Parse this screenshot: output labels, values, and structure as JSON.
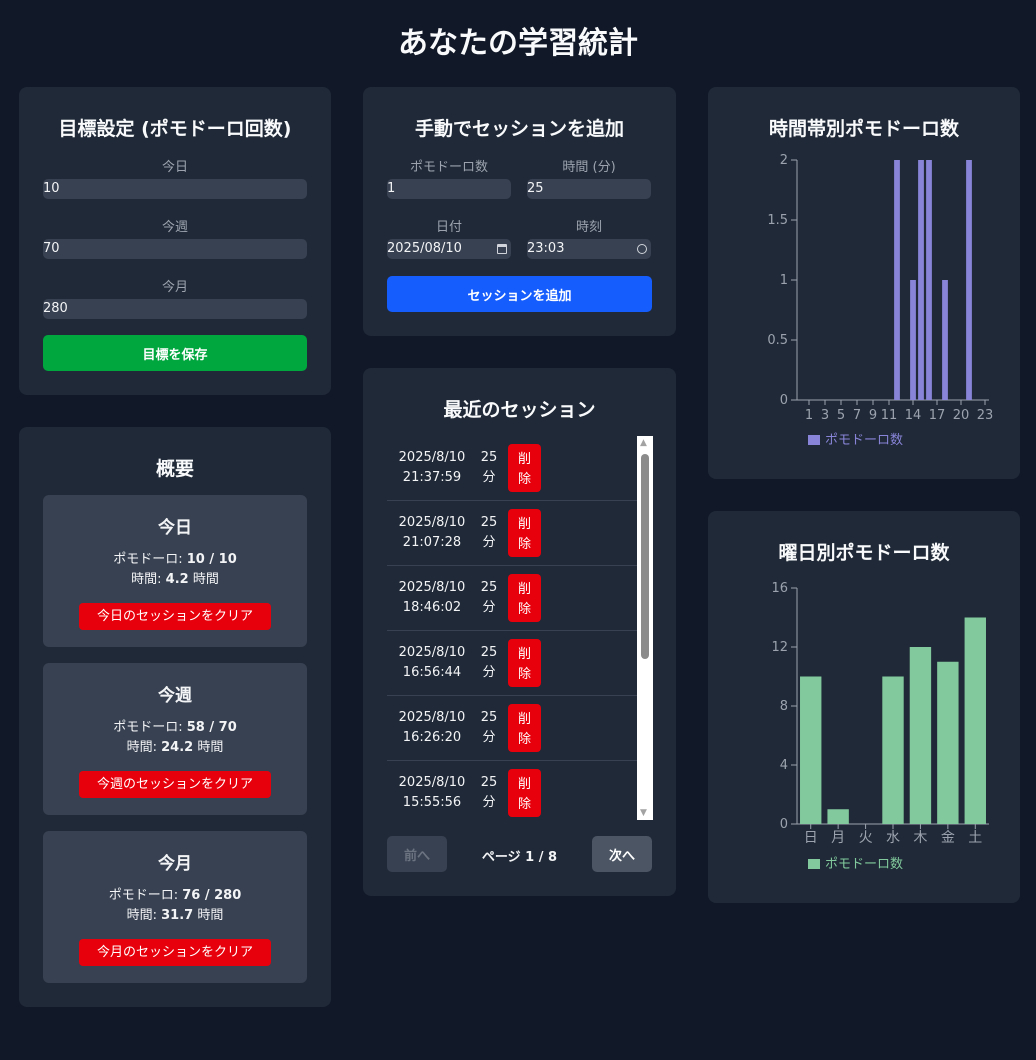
{
  "page": {
    "title": "あなたの学習統計"
  },
  "goals": {
    "title": "目標設定 (ポモドーロ回数)",
    "today_label": "今日",
    "today_value": "10",
    "week_label": "今週",
    "week_value": "70",
    "month_label": "今月",
    "month_value": "280",
    "save_button": "目標を保存"
  },
  "overview": {
    "title": "概要",
    "today": {
      "title": "今日",
      "pomo_label": "ポモドーロ: ",
      "pomo_value": "10 / 10",
      "time_label": "時間: ",
      "time_value": "4.2",
      "time_unit": " 時間",
      "clear_button": "今日のセッションをクリア"
    },
    "week": {
      "title": "今週",
      "pomo_label": "ポモドーロ: ",
      "pomo_value": "58 / 70",
      "time_label": "時間: ",
      "time_value": "24.2",
      "time_unit": " 時間",
      "clear_button": "今週のセッションをクリア"
    },
    "month": {
      "title": "今月",
      "pomo_label": "ポモドーロ: ",
      "pomo_value": "76 / 280",
      "time_label": "時間: ",
      "time_value": "31.7",
      "time_unit": " 時間",
      "clear_button": "今月のセッションをクリア"
    }
  },
  "manual": {
    "title": "手動でセッションを追加",
    "count_label": "ポモドーロ数",
    "count_value": "1",
    "minutes_label": "時間 (分)",
    "minutes_value": "25",
    "date_label": "日付",
    "date_value": "2025/08/10",
    "time_label": "時刻",
    "time_value": "23:03",
    "add_button": "セッションを追加"
  },
  "recent": {
    "title": "最近のセッション",
    "delete_label_1": "削",
    "delete_label_2": "除",
    "sessions": [
      {
        "date": "2025/8/10",
        "time": "21:37:59",
        "dur_num": "25",
        "dur_unit": "分"
      },
      {
        "date": "2025/8/10",
        "time": "21:07:28",
        "dur_num": "25",
        "dur_unit": "分"
      },
      {
        "date": "2025/8/10",
        "time": "18:46:02",
        "dur_num": "25",
        "dur_unit": "分"
      },
      {
        "date": "2025/8/10",
        "time": "16:56:44",
        "dur_num": "25",
        "dur_unit": "分"
      },
      {
        "date": "2025/8/10",
        "time": "16:26:20",
        "dur_num": "25",
        "dur_unit": "分"
      },
      {
        "date": "2025/8/10",
        "time": "15:55:56",
        "dur_num": "25",
        "dur_unit": "分"
      }
    ],
    "prev_button": "前へ",
    "page_info": "ページ 1 / 8",
    "next_button": "次へ"
  },
  "colors": {
    "hour_bar": "#8884d8",
    "weekday_bar": "#82ca9d",
    "axis": "#9ca3af"
  },
  "chart_data": [
    {
      "type": "bar",
      "title": "時間帯別ポモドーロ数",
      "x": [
        0,
        1,
        2,
        3,
        4,
        5,
        6,
        7,
        8,
        9,
        10,
        11,
        12,
        13,
        14,
        15,
        16,
        17,
        18,
        19,
        20,
        21,
        22,
        23
      ],
      "x_tick_labels": [
        "1",
        "3",
        "5",
        "7",
        "9",
        "11",
        "14",
        "17",
        "20",
        "23"
      ],
      "series": [
        {
          "name": "ポモドーロ数",
          "values": [
            0,
            0,
            0,
            0,
            0,
            0,
            0,
            0,
            0,
            0,
            0,
            0,
            2,
            0,
            1,
            2,
            2,
            0,
            1,
            0,
            0,
            2,
            0,
            0
          ]
        }
      ],
      "y_ticks": [
        "0",
        "0.5",
        "1",
        "1.5",
        "2"
      ],
      "ylim": [
        0,
        2
      ]
    },
    {
      "type": "bar",
      "title": "曜日別ポモドーロ数",
      "categories": [
        "日",
        "月",
        "火",
        "水",
        "木",
        "金",
        "土"
      ],
      "series": [
        {
          "name": "ポモドーロ数",
          "values": [
            10,
            1,
            0,
            10,
            12,
            11,
            14
          ]
        }
      ],
      "y_ticks": [
        "0",
        "4",
        "8",
        "12",
        "16"
      ],
      "ylim": [
        0,
        16
      ]
    }
  ]
}
